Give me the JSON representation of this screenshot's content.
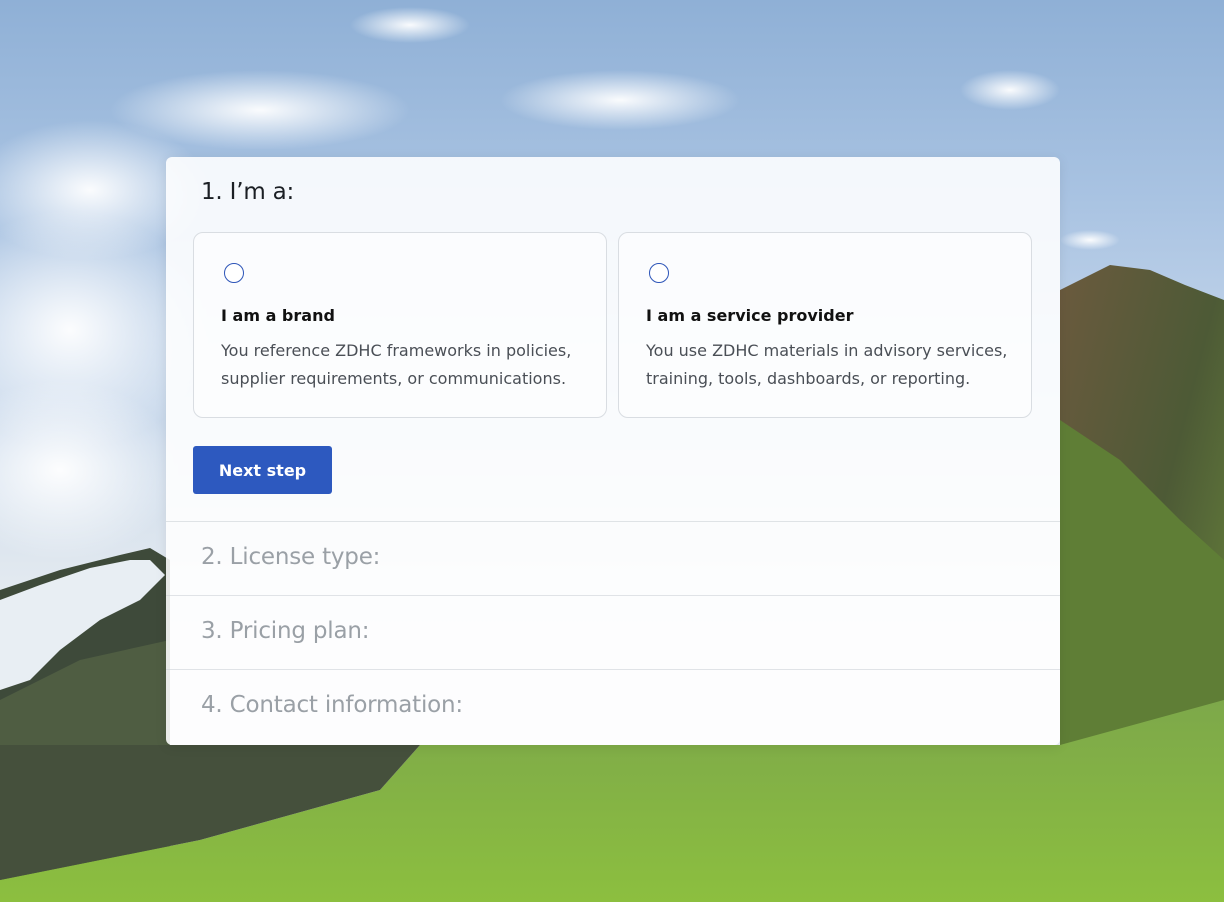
{
  "steps": {
    "current": {
      "title": "1. I’m a:",
      "options": [
        {
          "title": "I am a brand",
          "description": "You reference ZDHC frameworks in policies, supplier requirements, or communications."
        },
        {
          "title": "I am a service provider",
          "description": "You use ZDHC materials in advisory services, training, tools, dashboards, or reporting."
        }
      ],
      "next_label": "Next step"
    },
    "collapsed": [
      {
        "title": "2. License type:"
      },
      {
        "title": "3. Pricing plan:"
      },
      {
        "title": "4. Contact information:"
      }
    ]
  },
  "colors": {
    "accent": "#2d59bf",
    "radio_border": "#2d55b8",
    "muted_text": "#9aa0a6"
  }
}
